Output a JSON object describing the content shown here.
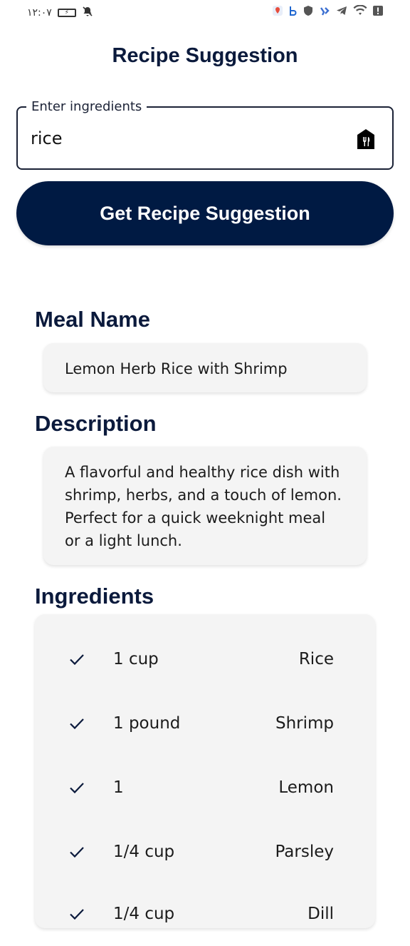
{
  "status_bar": {
    "time": "۱۲:۰۷",
    "battery": "⚡"
  },
  "app": {
    "title": "Recipe Suggestion"
  },
  "search": {
    "label": "Enter ingredients",
    "value": "rice",
    "icon": "restaurant-icon"
  },
  "actions": {
    "primary_label": "Get Recipe Suggestion"
  },
  "meal": {
    "heading": "Meal Name",
    "name": "Lemon Herb Rice with Shrimp"
  },
  "description": {
    "heading": "Description",
    "text": "A flavorful and healthy rice dish with shrimp, herbs, and a touch of lemon. Perfect for a quick weeknight meal or a light lunch."
  },
  "ingredients": {
    "heading": "Ingredients",
    "items": [
      {
        "qty": "1 cup",
        "name": "Rice"
      },
      {
        "qty": "1 pound",
        "name": "Shrimp"
      },
      {
        "qty": "1",
        "name": "Lemon"
      },
      {
        "qty": "1/4 cup",
        "name": "Parsley"
      },
      {
        "qty": "1/4 cup",
        "name": "Dill"
      }
    ]
  },
  "colors": {
    "primary": "#001a43",
    "heading": "#0b1a3c",
    "card_bg": "#f4f4f4"
  }
}
